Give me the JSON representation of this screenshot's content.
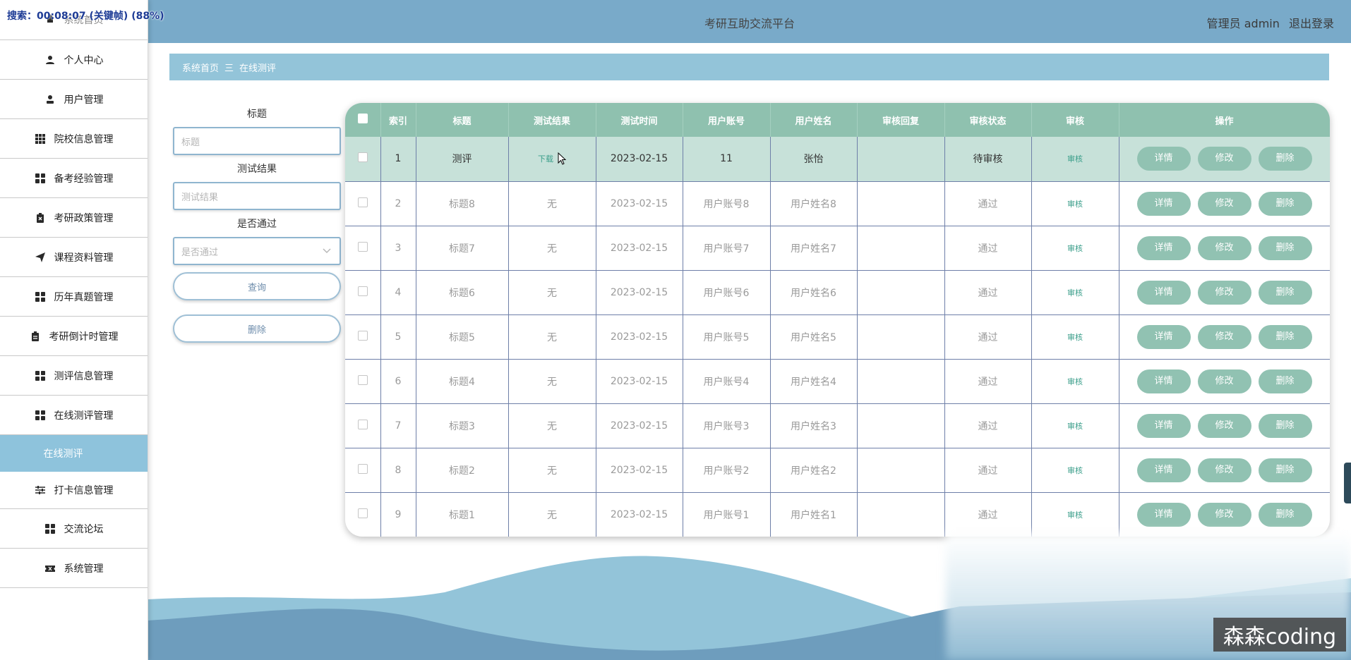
{
  "overlay": "搜索：00:08:07 (关键帧) (88%)",
  "header": {
    "title": "考研互助交流平台",
    "user": "管理员 admin",
    "logout": "退出登录"
  },
  "sidebar": {
    "items": [
      {
        "label": "系统首页",
        "icon": "home-icon"
      },
      {
        "label": "个人中心",
        "icon": "user-icon"
      },
      {
        "label": "用户管理",
        "icon": "user-admin-icon"
      },
      {
        "label": "院校信息管理",
        "icon": "grid-icon"
      },
      {
        "label": "备考经验管理",
        "icon": "apps-icon"
      },
      {
        "label": "考研政策管理",
        "icon": "clipboard-x-icon"
      },
      {
        "label": "课程资料管理",
        "icon": "send-icon"
      },
      {
        "label": "历年真题管理",
        "icon": "apps-icon"
      },
      {
        "label": "考研倒计时管理",
        "icon": "clipboard-icon"
      },
      {
        "label": "测评信息管理",
        "icon": "apps-icon"
      },
      {
        "label": "在线测评管理",
        "icon": "apps-icon"
      },
      {
        "label": "在线测评",
        "icon": ""
      },
      {
        "label": "打卡信息管理",
        "icon": "sliders-icon"
      },
      {
        "label": "交流论坛",
        "icon": "apps-icon"
      },
      {
        "label": "系统管理",
        "icon": "ticket-icon"
      }
    ]
  },
  "breadcrumb": {
    "home": "系统首页",
    "separator": "三",
    "current": "在线测评"
  },
  "search": {
    "title_label": "标题",
    "title_placeholder": "标题",
    "result_label": "测试结果",
    "result_placeholder": "测试结果",
    "pass_label": "是否通过",
    "pass_placeholder": "是否通过",
    "query_button": "查询",
    "delete_button": "删除"
  },
  "table": {
    "headers": [
      "索引",
      "标题",
      "测试结果",
      "测试时间",
      "用户账号",
      "用户姓名",
      "审核回复",
      "审核状态",
      "审核",
      "操作"
    ],
    "rows": [
      {
        "idx": "1",
        "title": "测评",
        "result": "下载",
        "time": "2023-02-15",
        "account": "11",
        "name": "张怡",
        "reply": "",
        "status": "待审核",
        "audit": "审核"
      },
      {
        "idx": "2",
        "title": "标题8",
        "result": "无",
        "time": "2023-02-15",
        "account": "用户账号8",
        "name": "用户姓名8",
        "reply": "",
        "status": "通过",
        "audit": "审核"
      },
      {
        "idx": "3",
        "title": "标题7",
        "result": "无",
        "time": "2023-02-15",
        "account": "用户账号7",
        "name": "用户姓名7",
        "reply": "",
        "status": "通过",
        "audit": "审核"
      },
      {
        "idx": "4",
        "title": "标题6",
        "result": "无",
        "time": "2023-02-15",
        "account": "用户账号6",
        "name": "用户姓名6",
        "reply": "",
        "status": "通过",
        "audit": "审核"
      },
      {
        "idx": "5",
        "title": "标题5",
        "result": "无",
        "time": "2023-02-15",
        "account": "用户账号5",
        "name": "用户姓名5",
        "reply": "",
        "status": "通过",
        "audit": "审核"
      },
      {
        "idx": "6",
        "title": "标题4",
        "result": "无",
        "time": "2023-02-15",
        "account": "用户账号4",
        "name": "用户姓名4",
        "reply": "",
        "status": "通过",
        "audit": "审核"
      },
      {
        "idx": "7",
        "title": "标题3",
        "result": "无",
        "time": "2023-02-15",
        "account": "用户账号3",
        "name": "用户姓名3",
        "reply": "",
        "status": "通过",
        "audit": "审核"
      },
      {
        "idx": "8",
        "title": "标题2",
        "result": "无",
        "time": "2023-02-15",
        "account": "用户账号2",
        "name": "用户姓名2",
        "reply": "",
        "status": "通过",
        "audit": "审核"
      },
      {
        "idx": "9",
        "title": "标题1",
        "result": "无",
        "time": "2023-02-15",
        "account": "用户账号1",
        "name": "用户姓名1",
        "reply": "",
        "status": "通过",
        "audit": "审核"
      }
    ],
    "actions": {
      "detail": "详情",
      "edit": "修改",
      "delete": "删除"
    }
  },
  "watermark": "森森coding",
  "colors": {
    "header": "#79aac9",
    "table_header": "#8fc1af",
    "action_button": "#91c2b2",
    "active_menu": "#8ec3dc",
    "breadcrumb": "#93c4d9"
  }
}
